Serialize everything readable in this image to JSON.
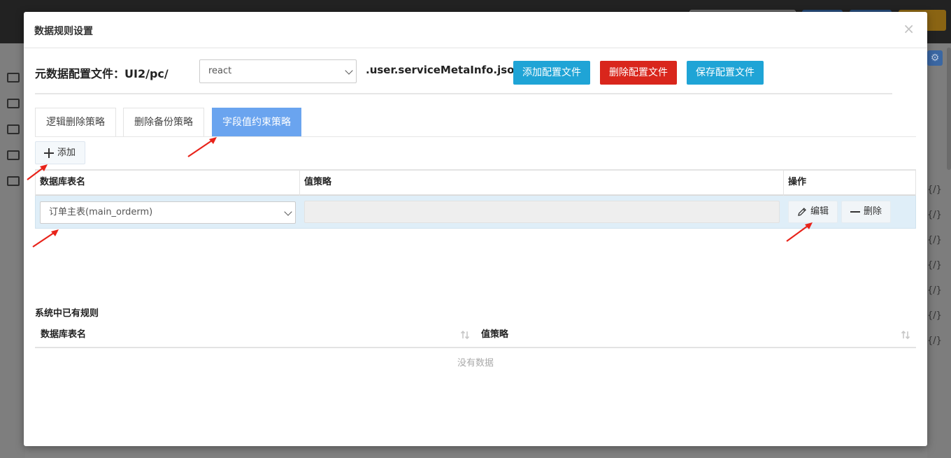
{
  "modal": {
    "title": "数据规则设置",
    "close_glyph": "×"
  },
  "config": {
    "label": "元数据配置文件：",
    "path": "UI2/pc/",
    "selected": "react",
    "suffix": ".user.serviceMetaInfo.json",
    "add_label": "添加配置文件",
    "delete_label": "删除配置文件",
    "save_label": "保存配置文件"
  },
  "tabs": [
    {
      "label": "逻辑删除策略",
      "active": false
    },
    {
      "label": "删除备份策略",
      "active": false
    },
    {
      "label": "字段值约束策略",
      "active": true
    }
  ],
  "add_button": {
    "label": "添加"
  },
  "rule_table": {
    "columns": [
      "数据库表名",
      "值策略",
      "操作"
    ],
    "rows": [
      {
        "table_name": "订单主表(main_orderm)",
        "strategy": "",
        "edit_label": "编辑",
        "delete_label": "删除"
      }
    ]
  },
  "existing": {
    "title": "系统中已有规则",
    "columns": [
      "数据库表名",
      "值策略"
    ],
    "empty_text": "没有数据"
  },
  "colors": {
    "primary": "#1fa4d6",
    "danger": "#d9261c",
    "active_tab": "#6aa4ef",
    "row_highlight": "#dfeef8",
    "annotation_arrow": "#e8231a"
  },
  "background": {
    "right_glyphs": [
      "{/}",
      "{/}",
      "{/}",
      "{/}",
      "{/}",
      "{/}",
      "{/}"
    ]
  }
}
